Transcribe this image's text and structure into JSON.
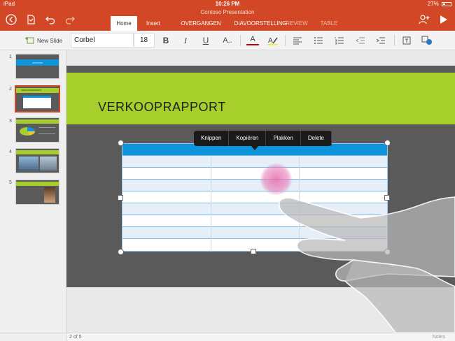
{
  "status": {
    "device": "iPad",
    "time": "10:26 PM",
    "battery": "27%"
  },
  "app": {
    "title": "Contoso Presentation",
    "accent": "#d24726"
  },
  "tabs": [
    {
      "label": "Home",
      "active": true
    },
    {
      "label": "Insert",
      "active": false
    },
    {
      "label": "OVERGANGEN",
      "active": false
    },
    {
      "label": "DIAVOORSTELLING",
      "active": false
    },
    {
      "label": "REVIEW",
      "active": false
    },
    {
      "label": "TABLE",
      "active": false
    }
  ],
  "toolbar": {
    "new_slide_label": "New Slide",
    "font_name": "Corbel",
    "font_size": "18",
    "bold": "B",
    "italic": "I",
    "underline": "U",
    "more_font": "A..",
    "font_color": "A"
  },
  "thumbnails": [
    {
      "number": "1",
      "text": "CONTOSO",
      "selected": false
    },
    {
      "number": "2",
      "text": "VERKOOPRAPPORT",
      "selected": true
    },
    {
      "number": "3",
      "text": "",
      "selected": false
    },
    {
      "number": "4",
      "text": "",
      "selected": false
    },
    {
      "number": "5",
      "text": "",
      "selected": false
    }
  ],
  "slide": {
    "title": "VERKOOPRAPPORT",
    "band_color": "#a6cf2c",
    "table_header_color": "#0e94da"
  },
  "context_menu": [
    "Knippen",
    "Kopiëren",
    "Plakken",
    "Delete"
  ],
  "footer": {
    "page": "2 of 5",
    "notes": "Notes"
  }
}
